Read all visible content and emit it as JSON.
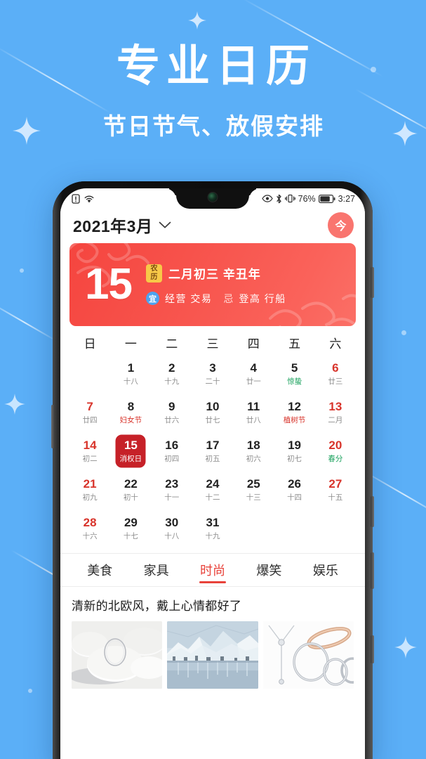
{
  "hero": {
    "title": "专业日历",
    "subtitle": "节日节气、放假安排"
  },
  "colors": {
    "background": "#5BAFF7",
    "banner_red": "#F7524B",
    "accent_red": "#E8423A",
    "selected_day": "#C62128",
    "today_button": "#F9756F",
    "lunar_badge": "#F7C948",
    "yi_badge": "#4DA3F0",
    "solar_term_green": "#17A05B"
  },
  "phone": {
    "statusbar": {
      "left_icons": [
        "sim-alert-icon",
        "wifi-icon"
      ],
      "right_icons": [
        "eye-icon",
        "bluetooth-icon",
        "vibrate-icon",
        "battery-icon"
      ],
      "battery_percent": "76%",
      "time": "3:27"
    },
    "titlebar": {
      "month_title": "2021年3月",
      "chevron": "chevron-down-icon",
      "today_button_label": "今"
    },
    "banner": {
      "day": "15",
      "lunar_badge_line1": "农",
      "lunar_badge_line2": "历",
      "lunar_date": "二月初三 辛丑年",
      "yi_badge": "宜",
      "yi_items": "经营 交易",
      "ji_label": "忌",
      "ji_items": "登高 行船"
    },
    "calendar": {
      "weekdays": [
        "日",
        "一",
        "二",
        "三",
        "四",
        "五",
        "六"
      ],
      "weeks": [
        [
          {
            "num": "",
            "sub": "",
            "type": "empty"
          },
          {
            "num": "1",
            "sub": "十八",
            "type": "normal"
          },
          {
            "num": "2",
            "sub": "十九",
            "type": "normal"
          },
          {
            "num": "3",
            "sub": "二十",
            "type": "normal"
          },
          {
            "num": "4",
            "sub": "廿一",
            "type": "normal"
          },
          {
            "num": "5",
            "sub": "惊蛰",
            "type": "term"
          },
          {
            "num": "6",
            "sub": "廿三",
            "type": "red"
          }
        ],
        [
          {
            "num": "7",
            "sub": "廿四",
            "type": "red"
          },
          {
            "num": "8",
            "sub": "妇女节",
            "type": "festival"
          },
          {
            "num": "9",
            "sub": "廿六",
            "type": "normal"
          },
          {
            "num": "10",
            "sub": "廿七",
            "type": "normal"
          },
          {
            "num": "11",
            "sub": "廿八",
            "type": "normal"
          },
          {
            "num": "12",
            "sub": "植树节",
            "type": "festival"
          },
          {
            "num": "13",
            "sub": "二月",
            "type": "red"
          }
        ],
        [
          {
            "num": "14",
            "sub": "初二",
            "type": "red"
          },
          {
            "num": "15",
            "sub": "消权日",
            "type": "selected"
          },
          {
            "num": "16",
            "sub": "初四",
            "type": "normal"
          },
          {
            "num": "17",
            "sub": "初五",
            "type": "normal"
          },
          {
            "num": "18",
            "sub": "初六",
            "type": "normal"
          },
          {
            "num": "19",
            "sub": "初七",
            "type": "normal"
          },
          {
            "num": "20",
            "sub": "春分",
            "type": "red-term"
          }
        ],
        [
          {
            "num": "21",
            "sub": "初九",
            "type": "red"
          },
          {
            "num": "22",
            "sub": "初十",
            "type": "normal"
          },
          {
            "num": "23",
            "sub": "十一",
            "type": "normal"
          },
          {
            "num": "24",
            "sub": "十二",
            "type": "normal"
          },
          {
            "num": "25",
            "sub": "十三",
            "type": "normal"
          },
          {
            "num": "26",
            "sub": "十四",
            "type": "normal"
          },
          {
            "num": "27",
            "sub": "十五",
            "type": "red"
          }
        ],
        [
          {
            "num": "28",
            "sub": "十六",
            "type": "red"
          },
          {
            "num": "29",
            "sub": "十七",
            "type": "normal"
          },
          {
            "num": "30",
            "sub": "十八",
            "type": "normal"
          },
          {
            "num": "31",
            "sub": "十九",
            "type": "normal"
          },
          {
            "num": "",
            "sub": "",
            "type": "empty"
          },
          {
            "num": "",
            "sub": "",
            "type": "empty"
          },
          {
            "num": "",
            "sub": "",
            "type": "empty"
          }
        ]
      ]
    },
    "tabs": [
      {
        "label": "美食",
        "active": false
      },
      {
        "label": "家具",
        "active": false
      },
      {
        "label": "时尚",
        "active": true
      },
      {
        "label": "爆笑",
        "active": false
      },
      {
        "label": "娱乐",
        "active": false
      }
    ],
    "feed": {
      "article_title": "清新的北欧风，戴上心情都好了",
      "thumbnails": [
        {
          "name": "thumbnail-ceramic-ring"
        },
        {
          "name": "thumbnail-snow-lake"
        },
        {
          "name": "thumbnail-jewelry-rings"
        }
      ]
    }
  }
}
